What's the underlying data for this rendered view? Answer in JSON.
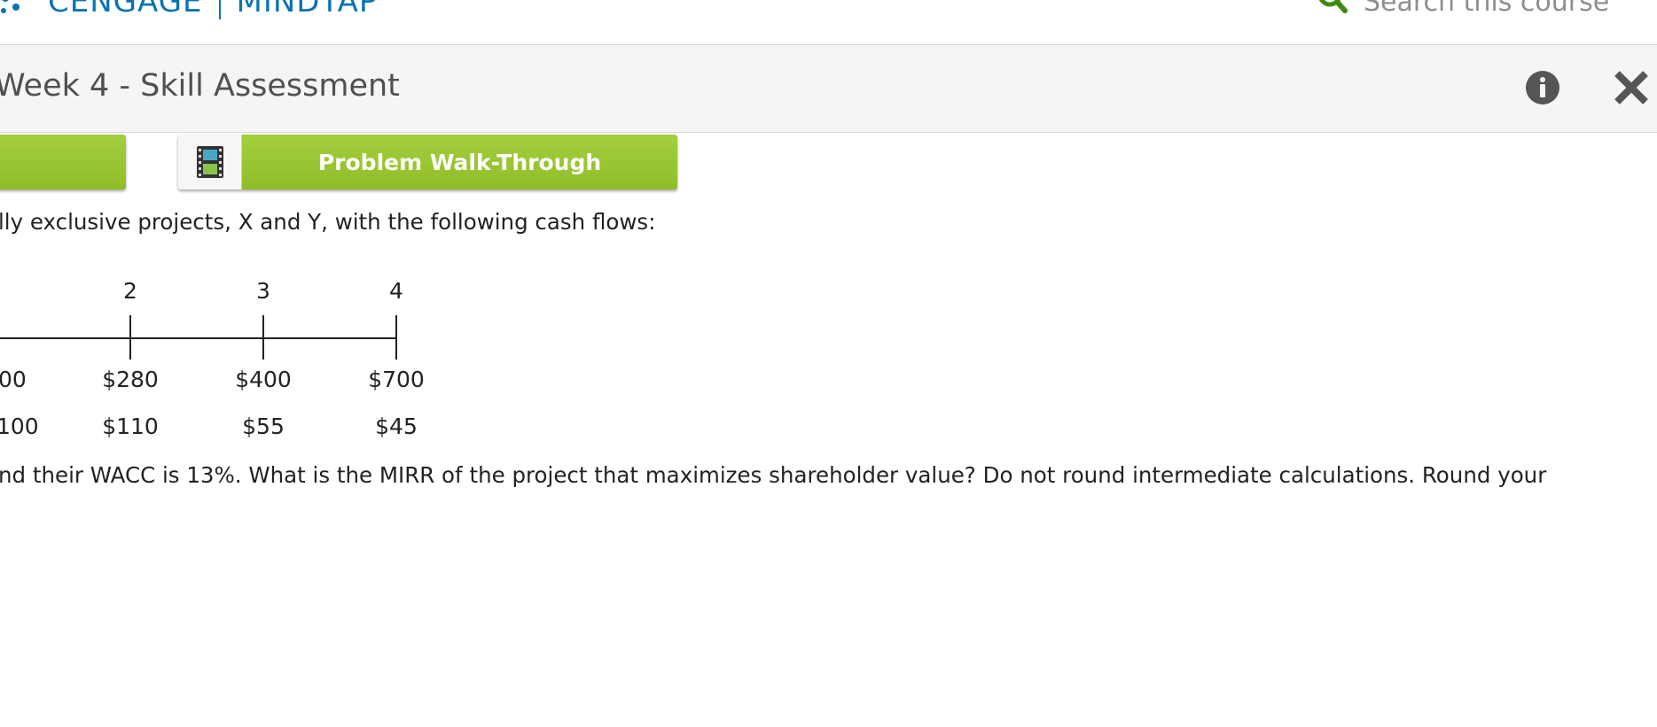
{
  "header": {
    "brand_name": "CENGAGE",
    "product_name": "MINDTAP",
    "search_placeholder": "Search this course",
    "accent_color": "#0a72b4",
    "search_icon_color": "#3d8b12"
  },
  "title_bar": {
    "title": "Week 4 - Skill Assessment",
    "icons": [
      "info-icon",
      "close-icon"
    ]
  },
  "buttons": {
    "left_button_label": "",
    "walkthrough_label": "Problem Walk-Through",
    "walkthrough_icon": "film-icon",
    "color": "#97c430"
  },
  "question": {
    "intro": "lly exclusive projects, X and Y, with the following cash flows:",
    "prompt": "nd their WACC is 13%. What is the MIRR of the project that maximizes shareholder value? Do not round intermediate calculations. Round your"
  },
  "timeline": {
    "periods": [
      "2",
      "3",
      "4"
    ],
    "project_x": {
      "partial_first": "00",
      "values": [
        "$280",
        "$400",
        "$700"
      ]
    },
    "project_y": {
      "partial_first": "100",
      "values": [
        "$110",
        "$55",
        "$45"
      ]
    }
  }
}
